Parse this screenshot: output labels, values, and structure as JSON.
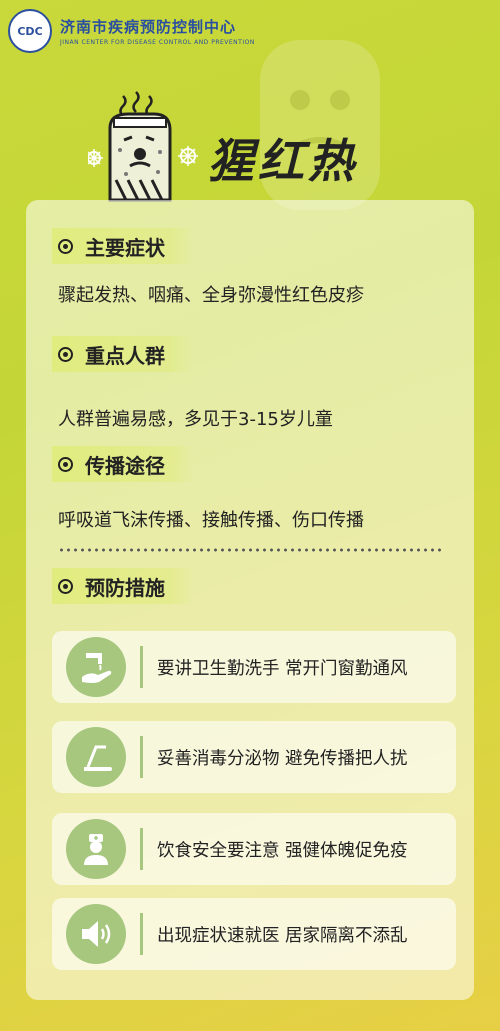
{
  "header": {
    "logo_text": "CDC",
    "org_cn": "济南市疾病预防控制中心",
    "org_en": "JINAN CENTER FOR DISEASE CONTROL AND PREVENTION"
  },
  "title": "猩红热",
  "sections": [
    {
      "title": "主要症状",
      "body": "骤起发热、咽痛、全身弥漫性红色皮疹"
    },
    {
      "title": "重点人群",
      "body": "人群普遍易感，多见于3-15岁儿童"
    },
    {
      "title": "传播途径",
      "body": "呼吸道飞沫传播、接触传播、伤口传播"
    },
    {
      "title": "预防措施"
    }
  ],
  "prevention": [
    {
      "icon": "hand-washing-icon",
      "text": "要讲卫生勤洗手 常开门窗勤通风"
    },
    {
      "icon": "treadmill-icon",
      "text": "妥善消毒分泌物 避免传播把人扰"
    },
    {
      "icon": "doctor-icon",
      "text": "饮食安全要注意 强健体魄促免疫"
    },
    {
      "icon": "speaker-icon",
      "text": "出现症状速就医 居家隔离不添乱"
    }
  ],
  "colors": {
    "icon_green": "#a7c77f",
    "brand_blue": "#2a4fa0"
  }
}
